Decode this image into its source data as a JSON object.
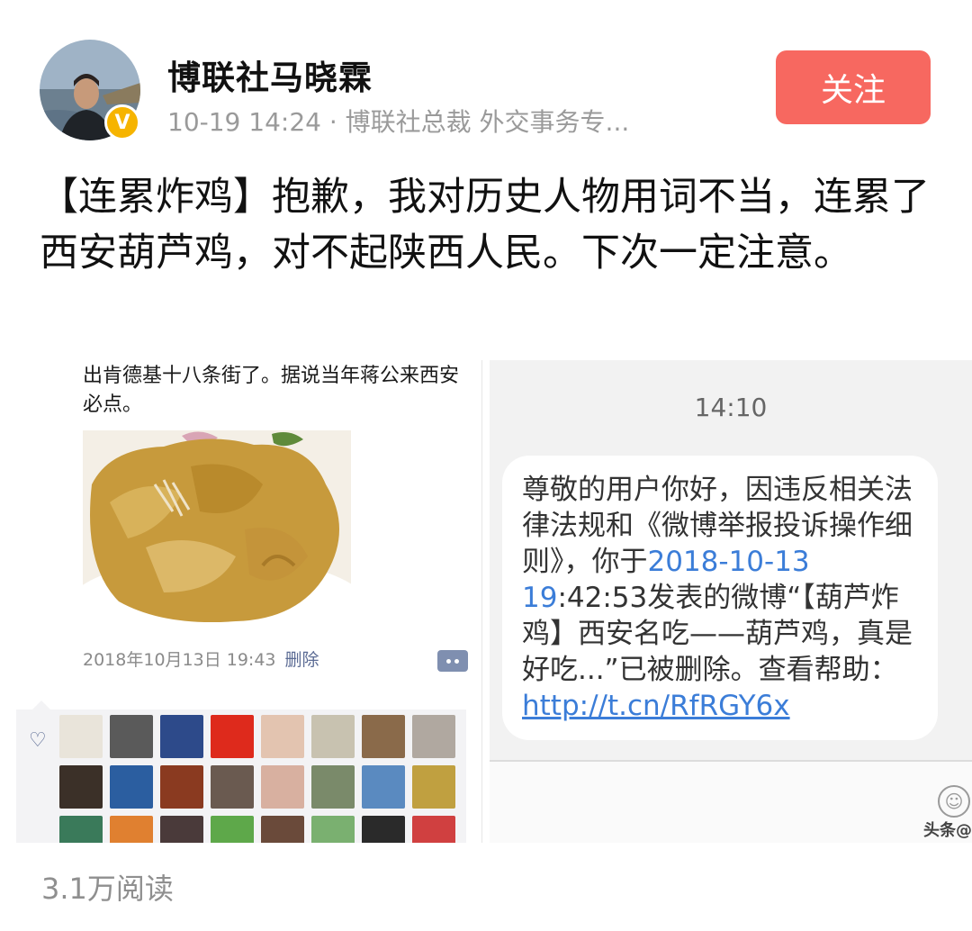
{
  "author": {
    "name": "博联社马晓霖",
    "meta": "10-19 14:24 · 博联社总裁 外交事务专...",
    "verified_label": "V",
    "avatar_icon": "avatar-icon"
  },
  "follow_button": {
    "label": "关注",
    "color": "#f76860"
  },
  "post": {
    "text": "【连累炸鸡】抱歉，我对历史人物用词不当，连累了西安葫芦鸡，对不起陕西人民。下次一定注意。"
  },
  "image_left": {
    "text": "出肯德基十八条街了。据说当年蒋公来西安必点。",
    "timestamp": "2018年10月13日 19:43",
    "delete_label": "删除",
    "heart_icon": "heart-icon",
    "comment_icon": "comment-icon"
  },
  "image_right": {
    "time": "14:10",
    "message_part1": "尊敬的用户你好，因违反相关法律法规和《微博举报投诉操作细则》，你于",
    "message_date": "2018-10-13 19",
    "message_part2": ":42:53发表的微博“【葫芦炸鸡】西安名吃——葫芦鸡，真是好吃...”已被删除。查看帮助：",
    "message_link": "http://t.cn/RfRGY6x",
    "watermark": "头条@",
    "emoji_icon": "smiley-icon"
  },
  "footer": {
    "reads": "3.1万阅读"
  }
}
